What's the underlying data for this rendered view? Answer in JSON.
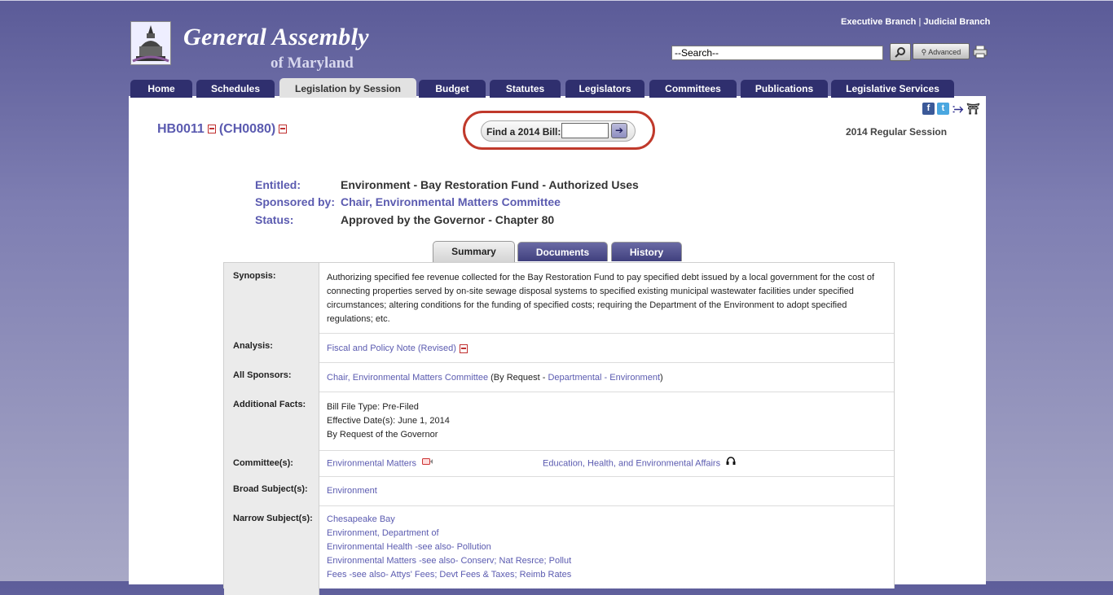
{
  "header": {
    "title": "General Assembly",
    "subtitle": "of Maryland",
    "branch_links": [
      "Executive Branch",
      "Judicial Branch"
    ],
    "search_placeholder": "--Search--",
    "advanced_label": "Advanced"
  },
  "nav": {
    "tabs": [
      {
        "label": "Home"
      },
      {
        "label": "Schedules"
      },
      {
        "label": "Legislation by Session",
        "active": true
      },
      {
        "label": "Budget"
      },
      {
        "label": "Statutes"
      },
      {
        "label": "Legislators"
      },
      {
        "label": "Committees"
      },
      {
        "label": "Publications"
      },
      {
        "label": "Legislative Services"
      }
    ]
  },
  "bill": {
    "id": "HB0011",
    "chapter": "(CH0080)",
    "finder_label": "Find a 2014 Bill:",
    "session": "2014 Regular Session",
    "entitled_label": "Entitled:",
    "entitled": "Environment - Bay Restoration Fund - Authorized Uses",
    "sponsored_label": "Sponsored by:",
    "sponsored": "Chair, Environmental Matters Committee",
    "status_label": "Status:",
    "status": "Approved by the Governor - Chapter 80"
  },
  "subtabs": [
    {
      "label": "Summary",
      "active": true
    },
    {
      "label": "Documents"
    },
    {
      "label": "History"
    }
  ],
  "details": {
    "synopsis_label": "Synopsis:",
    "synopsis": "Authorizing specified fee revenue collected for the Bay Restoration Fund to pay specified debt issued by a local government for the cost of connecting properties served by on-site sewage disposal systems to specified existing municipal wastewater facilities under specified circumstances; altering conditions for the funding of specified costs; requiring the Department of the Environment to adopt specified regulations; etc.",
    "analysis_label": "Analysis:",
    "analysis": "Fiscal and Policy Note (Revised)",
    "sponsors_label": "All Sponsors:",
    "sponsors_link": "Chair, Environmental Matters Committee",
    "sponsors_by": "(By Request -",
    "sponsors_dept": "Departmental - Environment",
    "sponsors_end": ")",
    "facts_label": "Additional Facts:",
    "facts": [
      "Bill File Type: Pre-Filed",
      "Effective Date(s): June 1, 2014",
      "By Request of the Governor"
    ],
    "committees_label": "Committee(s):",
    "committee_house": "Environmental Matters",
    "committee_senate": "Education, Health, and Environmental Affairs",
    "broad_label": "Broad Subject(s):",
    "broad": "Environment",
    "narrow_label": "Narrow Subject(s):",
    "narrow": [
      "Chesapeake Bay",
      "Environment, Department of",
      "Environmental Health -see also- Pollution",
      "Environmental Matters -see also- Conserv; Nat Resrce; Pollut",
      "Fees -see also- Attys' Fees; Devt Fees & Taxes; Reimb Rates"
    ]
  }
}
